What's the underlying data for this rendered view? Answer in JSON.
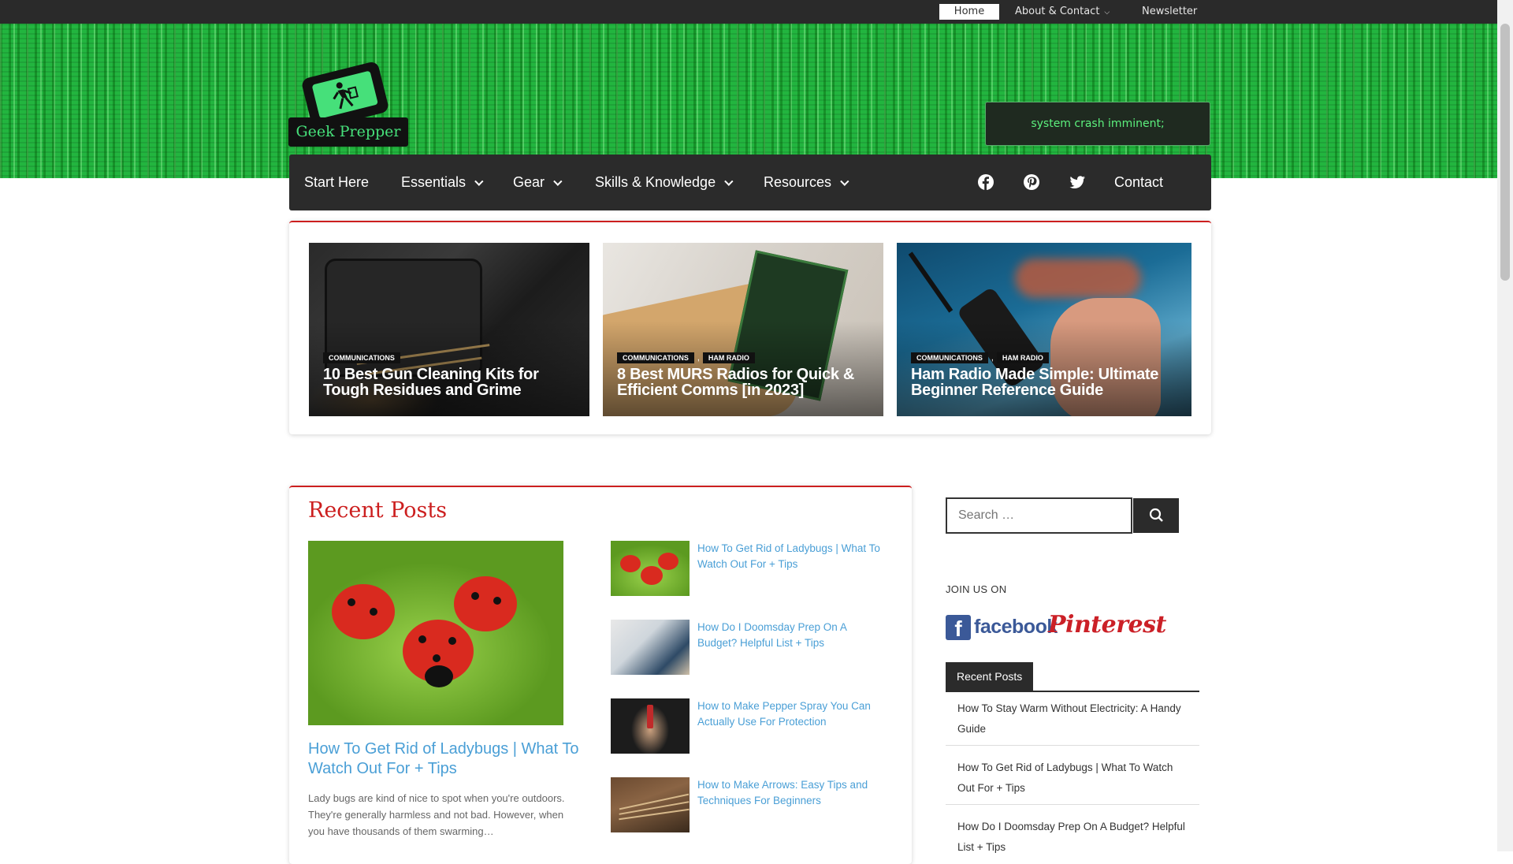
{
  "topbar": {
    "home": "Home",
    "about": "About & Contact",
    "newsletter": "Newsletter"
  },
  "header": {
    "logo_text": "Geek Prepper",
    "banner_text": "system crash imminent;"
  },
  "nav": {
    "items": [
      {
        "label": "Start Here"
      },
      {
        "label": "Essentials"
      },
      {
        "label": "Gear"
      },
      {
        "label": "Skills & Knowledge"
      },
      {
        "label": "Resources"
      }
    ],
    "social": [
      "facebook-icon",
      "pinterest-icon",
      "twitter-icon"
    ],
    "contact": "Contact"
  },
  "featured": [
    {
      "tags": [
        "COMMUNICATIONS"
      ],
      "title": "10 Best Gun Cleaning Kits for Tough Residues and Grime"
    },
    {
      "tags": [
        "COMMUNICATIONS",
        "HAM RADIO"
      ],
      "title": "8 Best MURS Radios for Quick & Efficient Comms [in 2023]"
    },
    {
      "tags": [
        "COMMUNICATIONS",
        "HAM RADIO"
      ],
      "title": "Ham Radio Made Simple: Ultimate Beginner Reference Guide"
    }
  ],
  "recent": {
    "heading": "Recent Posts",
    "main": {
      "title": "How To Get Rid of Ladybugs | What To Watch Out For + Tips",
      "excerpt": "Lady bugs are kind of nice to spot when you're outdoors. They're generally harmless and not bad. However, when you have thousands of them swarming…"
    },
    "list": [
      {
        "title": "How To Get Rid of Ladybugs | What To Watch Out For + Tips"
      },
      {
        "title": "How Do I Doomsday Prep On A Budget? Helpful List + Tips"
      },
      {
        "title": "How to Make Pepper Spray You Can Actually Use For Protection"
      },
      {
        "title": "How to Make Arrows: Easy Tips and Techniques For Beginners"
      }
    ]
  },
  "sidebar": {
    "search_placeholder": "Search …",
    "join_us": "JOIN US ON",
    "facebook_word": "facebook",
    "pinterest_word": "Pinterest",
    "recent_heading": "Recent Posts",
    "recent_items": [
      "How To Stay Warm Without Electricity: A Handy Guide",
      "How To Get Rid of Ladybugs | What To Watch Out For + Tips",
      "How Do I Doomsday Prep On A Budget? Helpful List + Tips"
    ]
  },
  "colors": {
    "accent_red": "#cc1f1f",
    "link_blue": "#4a9fd6",
    "header_green": "#22b53f",
    "nav_dark": "#2b2b2b"
  }
}
